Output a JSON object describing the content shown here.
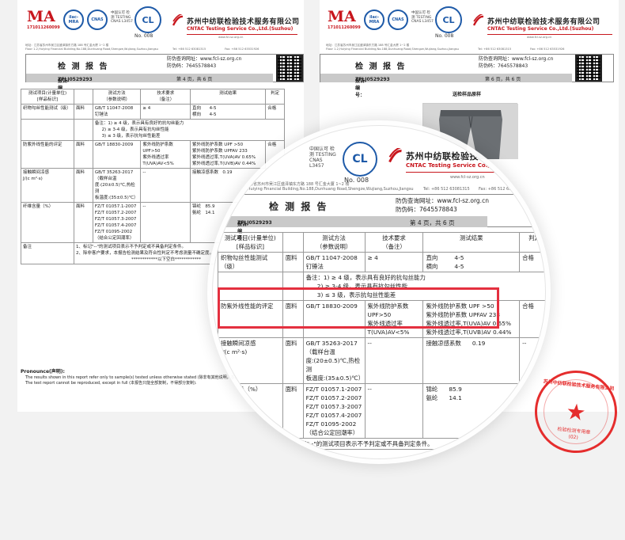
{
  "company": {
    "name_cn": "苏州中纺联检验技术服务有限公司",
    "name_en": "CNTAC Testing Service Co.,Ltd.(Suzhou)",
    "ma_number": "171011260099",
    "cnas_label": "CNAS",
    "cnas_text": "中国认可 检测 TESTING CNAS L3457",
    "ilac_label": "ilac-MRA",
    "cl_label": "CL",
    "cl_no": "No. 008",
    "address_cn": "地址：江苏省苏州市吴江区盛泽镇东方路 188 号汇金大厦 1~2 楼",
    "address_en": "Floor 1-2,Huiying Financial Building,No.188,Dunhuang Road,Shengze,Wujiang,Suzhou,Jiangsu",
    "website": "www.fcl-sz.org.cn",
    "tel": "Tel: +86 512 63081315",
    "fax": "Fax: +86 512 63531926"
  },
  "report": {
    "title": "检 测 报 告",
    "anti_fake_web_label": "防伪查询网址：",
    "anti_fake_web": "www.fcl-sz.org.cn",
    "anti_fake_code_label": "防伪码：",
    "anti_fake_code": "7645578843",
    "number_label": "报告编号：",
    "number": "ZFLJ0529293",
    "page4": "第 4 页，共 6 页",
    "page6": "第 6 页，共 6 页"
  },
  "table": {
    "headers": {
      "item": "测试项目(计量单位)",
      "item_sub": "[样品标识]",
      "method": "测试方法",
      "method_sub": "（参数说明）",
      "requirement": "技术要求",
      "requirement_sub": "（备注）",
      "result": "测试结果",
      "judgement": "判定"
    },
    "row_snag": {
      "item": "织物勾丝性能测试（级）",
      "sample": "面料",
      "method": "GB/T 11047-2008 钉锤法",
      "requirement": "≥ 4",
      "result_a_label": "直向",
      "result_a": "4-5",
      "result_b_label": "横向",
      "result_b": "4-5",
      "judgement": "合格",
      "note_label": "备注：",
      "note_1": "1) ≥ 4 级，表示具有良好的抗勾丝能力",
      "note_2": "2) ≥ 3-4 级，表示具有抗勾丝性能",
      "note_3": "3) ≤ 3 级，表示抗勾丝性能差"
    },
    "row_uv": {
      "item": "防紫外线性能的评定",
      "sample": "面料",
      "method": "GB/T 18830-2009",
      "req_1": "紫外线防护系数",
      "req_2": "UPF>50",
      "req_3": "紫外线透过率",
      "req_4": "T(UVA)AV<5%",
      "res_1": "紫外线防护系数 UPF",
      "res_1v": ">50",
      "res_2": "紫外线防护系数 UPFAV",
      "res_2v": "233",
      "res_3": "紫外线透过率,T(UVA)AV",
      "res_3v": "0.65%",
      "res_4": "紫外线透过率,T(UVB)AV",
      "res_4v": "0.44%",
      "judgement": "合格"
    },
    "row_cool": {
      "item": "接触瞬间凉感",
      "item_unit": "J/(c m²·s)",
      "sample": "面料",
      "method": "GB/T 35263-2017",
      "method_2": "（载样台温",
      "method_3": "度:(20±0.5)℃,热检测",
      "method_4": "板温度:(35±0.5)℃）",
      "requirement": "--",
      "result_label": "接触凉感系数",
      "result": "0.19",
      "judgement": "--"
    },
    "row_fiber": {
      "item": "纤维含量（%）",
      "sample": "面料",
      "method_1": "FZ/T 01057.1-2007",
      "method_2": "FZ/T 01057.2-2007",
      "method_3": "FZ/T 01057.3-2007",
      "method_4": "FZ/T 01057.4-2007",
      "method_5": "FZ/T 01095-2002",
      "method_6": "（结合公定回潮率）",
      "requirement": "--",
      "res_a_label": "锦纶",
      "res_a": "85.9",
      "res_b_label": "氨纶",
      "res_b": "14.1",
      "judgement": "--"
    },
    "row_note": {
      "label": "备注",
      "note_1": "1、标记\"--\"的测试项目表示不予判定或不具备判定条件。",
      "note_2": "2、除非客户要求，本报告检测结果及符合性判定不考虑测量不确定度。",
      "end": "************以下空白************"
    }
  },
  "pronounce": {
    "title": "Pronounce(声明):",
    "line_1": "The results shown in this report refer only to sample(s) tested unless otherwise stated (除非有其他说明，本报告结果仅对测试样品负责).",
    "line_2": "The test report cannot be reproduced, except in full (本报告只能全部复制，不得部分复制)."
  },
  "sample_page": {
    "title": "送检样品原样"
  },
  "stamp": {
    "arc": "苏州中纺联检验技术服务有限公司",
    "star": "★",
    "text": "检验检测专用章",
    "num": "(02)"
  },
  "colors": {
    "brand_red": "#c8161d",
    "highlight": "#e4303f",
    "stamp_red": "#e52d2d",
    "cert_blue": "#1e5aa8"
  }
}
